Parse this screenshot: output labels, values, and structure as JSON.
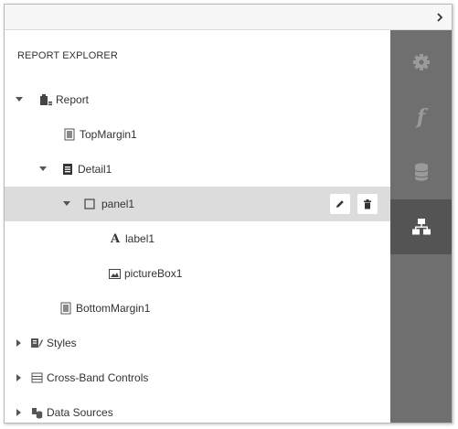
{
  "header": {
    "collapse_icon": "chevron-right-icon"
  },
  "panel": {
    "title": "REPORT EXPLORER"
  },
  "tree": [
    {
      "label": "Report",
      "icon": "report-icon",
      "expanded": true
    },
    {
      "label": "TopMargin1",
      "icon": "margin-band-icon"
    },
    {
      "label": "Detail1",
      "icon": "detail-band-icon",
      "expanded": true
    },
    {
      "label": "panel1",
      "icon": "panel-icon",
      "expanded": true,
      "selected": true
    },
    {
      "label": "label1",
      "icon": "label-icon",
      "glyph": "A"
    },
    {
      "label": "pictureBox1",
      "icon": "picture-icon"
    },
    {
      "label": "BottomMargin1",
      "icon": "margin-band-icon"
    },
    {
      "label": "Styles",
      "icon": "styles-icon",
      "expanded": false
    },
    {
      "label": "Cross-Band Controls",
      "icon": "cross-band-icon",
      "expanded": false
    },
    {
      "label": "Data Sources",
      "icon": "data-sources-icon",
      "expanded": false
    }
  ],
  "actions": {
    "edit_icon": "pencil-icon",
    "delete_icon": "trash-icon"
  },
  "sidebar": {
    "tabs": [
      {
        "icon": "gear-icon",
        "active": false
      },
      {
        "icon": "function-icon",
        "glyph": "f",
        "active": false
      },
      {
        "icon": "database-icon",
        "active": false
      },
      {
        "icon": "hierarchy-icon",
        "active": true
      }
    ]
  },
  "colors": {
    "sidebar_bg": "#6f6f6f",
    "sidebar_active_bg": "#545454",
    "sidebar_icon": "#9a9a9a",
    "sidebar_icon_active": "#ffffff",
    "selected_row_bg": "#dcdcdc",
    "text": "#333333"
  }
}
